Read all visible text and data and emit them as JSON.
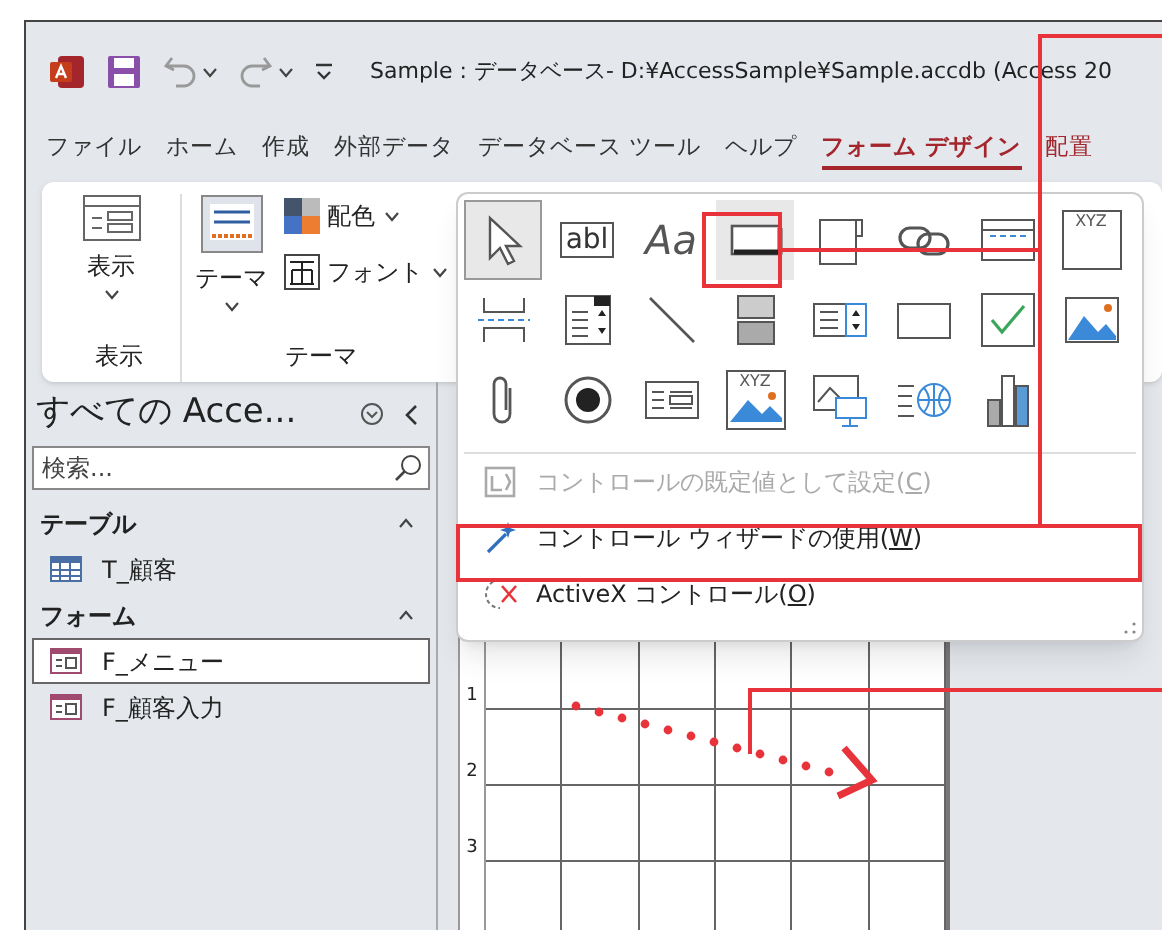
{
  "window": {
    "title": "Sample : データベース- D:¥AccessSample¥Sample.accdb (Access 20"
  },
  "tabs": [
    {
      "label": "ファイル",
      "selected": false,
      "contextual": false
    },
    {
      "label": "ホーム",
      "selected": false,
      "contextual": false
    },
    {
      "label": "作成",
      "selected": false,
      "contextual": false
    },
    {
      "label": "外部データ",
      "selected": false,
      "contextual": false
    },
    {
      "label": "データベース ツール",
      "selected": false,
      "contextual": false
    },
    {
      "label": "ヘルプ",
      "selected": false,
      "contextual": false
    },
    {
      "label": "フォーム デザイン",
      "selected": true,
      "contextual": true
    },
    {
      "label": "配置",
      "selected": false,
      "contextual": true
    }
  ],
  "ribbon": {
    "groups": [
      {
        "label": "表示",
        "buttons": [
          {
            "label": "表示",
            "kind": "large"
          }
        ]
      },
      {
        "label": "テーマ",
        "buttons": [
          {
            "label": "テーマ",
            "kind": "large"
          },
          {
            "label": "配色",
            "kind": "small"
          },
          {
            "label": "フォント",
            "kind": "small"
          }
        ]
      }
    ]
  },
  "navigation": {
    "title": "すべての Acce...",
    "search": {
      "placeholder": "検索..."
    },
    "groups": [
      {
        "label": "テーブル",
        "expanded": true,
        "items": [
          {
            "label": "T_顧客",
            "kind": "table",
            "selected": false
          }
        ]
      },
      {
        "label": "フォーム",
        "expanded": true,
        "items": [
          {
            "label": "F_メニュー",
            "kind": "form",
            "selected": true
          },
          {
            "label": "F_顧客入力",
            "kind": "form",
            "selected": false
          }
        ]
      }
    ]
  },
  "controls_palette": {
    "controls": [
      {
        "selected": true,
        "hover": false
      },
      {
        "selected": false,
        "hover": false,
        "glyph": "abl"
      },
      {
        "selected": false,
        "hover": false,
        "glyph": "Aa"
      },
      {
        "selected": false,
        "hover": true
      },
      {
        "selected": false,
        "hover": false
      },
      {
        "selected": false,
        "hover": false
      },
      {
        "selected": false,
        "hover": false
      },
      {
        "selected": false,
        "hover": false,
        "glyph": "XYZ"
      },
      {
        "selected": false,
        "hover": false
      },
      {
        "selected": false,
        "hover": false
      },
      {
        "selected": false,
        "hover": false
      },
      {
        "selected": false,
        "hover": false
      },
      {
        "selected": false,
        "hover": false
      },
      {
        "selected": false,
        "hover": false
      },
      {
        "selected": false,
        "hover": false
      },
      {
        "selected": false,
        "hover": false
      },
      {
        "selected": false,
        "hover": false
      },
      {
        "selected": false,
        "hover": false
      },
      {
        "selected": false,
        "hover": false
      },
      {
        "selected": false,
        "hover": false,
        "glyph": "XYZ"
      },
      {
        "selected": false,
        "hover": false
      },
      {
        "selected": false,
        "hover": false
      },
      {
        "selected": false,
        "hover": false
      }
    ],
    "menu_items": [
      {
        "before": "コントロールの既定値として設定(",
        "key": "C",
        "after": ")",
        "disabled": true
      },
      {
        "before": "コントロール ウィザードの使用(",
        "key": "W",
        "after": ")",
        "disabled": false
      },
      {
        "before": "ActiveX コントロール(",
        "key": "O",
        "after": ")",
        "disabled": false
      }
    ]
  },
  "design_area": {
    "ruler_marks": [
      "1",
      "2",
      "3"
    ]
  }
}
